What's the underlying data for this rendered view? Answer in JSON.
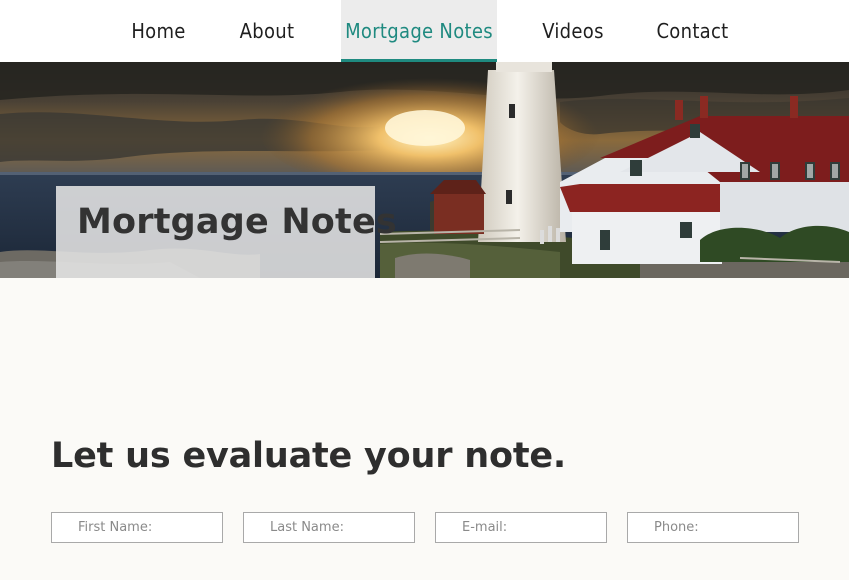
{
  "nav": {
    "items": [
      {
        "label": "Home"
      },
      {
        "label": "About"
      },
      {
        "label": "Mortgage Notes"
      },
      {
        "label": "Videos"
      },
      {
        "label": "Contact"
      }
    ],
    "active_item": "Mortgage Notes",
    "accent_color": "#1f8a80"
  },
  "hero": {
    "title": "Mortgage Notes"
  },
  "content": {
    "heading": "Let us evaluate your note."
  },
  "form": {
    "first_name_placeholder": "First Name:",
    "last_name_placeholder": "Last Name:",
    "email_placeholder": "E-mail:",
    "phone_placeholder": "Phone:"
  }
}
